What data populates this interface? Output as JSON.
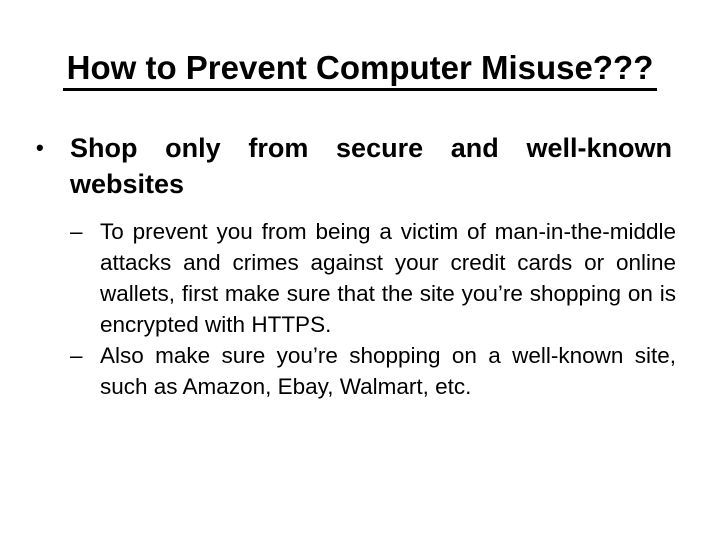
{
  "slide": {
    "title": "How to Prevent Computer Misuse???",
    "bullets": [
      {
        "marker": "•",
        "text": "Shop only from secure and well-known websites",
        "sub_items": [
          {
            "marker": "–",
            "text": "To prevent you from being a victim of man-in-the-middle attacks and crimes against your credit cards or online wallets, first make sure that the site you’re shopping on is encrypted with HTTPS."
          },
          {
            "marker": "–",
            "text": "Also make sure you’re shopping on a well-known site, such as Amazon, Ebay, Walmart, etc."
          }
        ]
      }
    ]
  }
}
